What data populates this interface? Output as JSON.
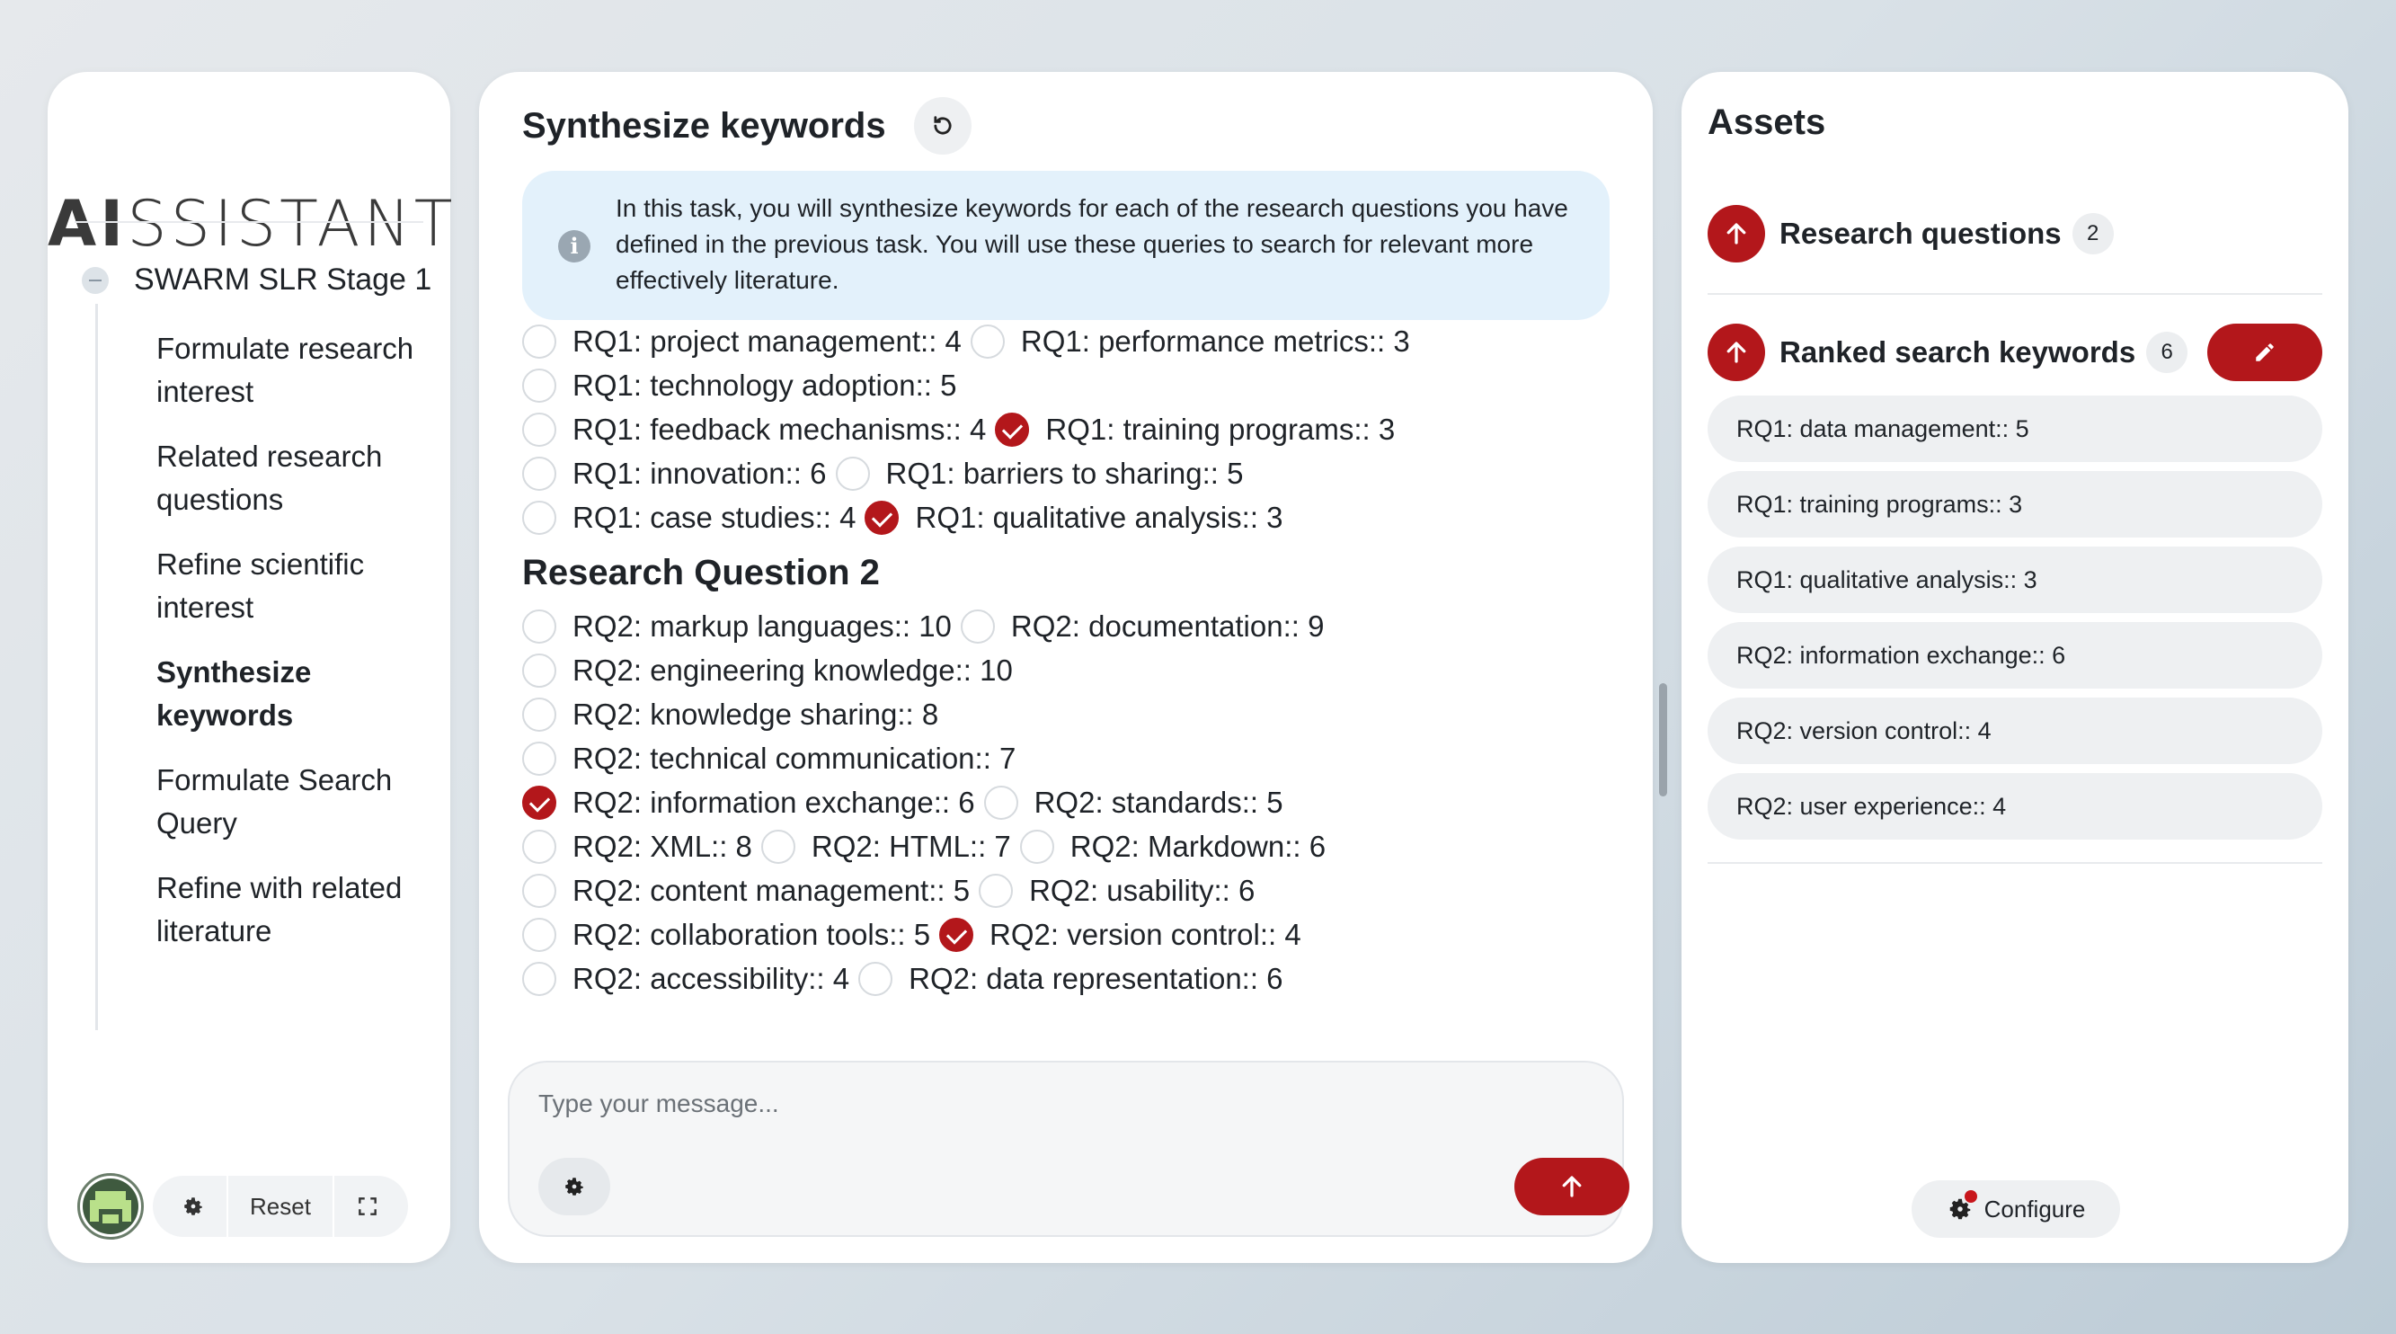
{
  "left_panel": {
    "logo_bold": "AI",
    "logo_rest": "SSISTANT",
    "stage_label": "SWARM SLR Stage 1",
    "nav_items": [
      {
        "label": "Formulate research interest"
      },
      {
        "label": "Related research questions"
      },
      {
        "label": "Refine scientific interest"
      },
      {
        "label": "Synthesize keywords"
      },
      {
        "label": "Formulate Search Query"
      },
      {
        "label": "Refine with related literature"
      }
    ],
    "active_index": 3,
    "reset_label": "Reset"
  },
  "main": {
    "title": "Synthesize keywords",
    "info_text": "In this task, you will synthesize keywords for each of the research questions you have defined in the previous task. You will use these queries to search for relevant more effectively literature.",
    "rq1_rows": [
      [
        {
          "label": "RQ1: project management:: 4",
          "checked": false
        },
        {
          "label": "RQ1: performance metrics:: 3",
          "checked": false
        }
      ],
      [
        {
          "label": "RQ1: technology adoption:: 5",
          "checked": false
        }
      ],
      [
        {
          "label": "RQ1: feedback mechanisms:: 4",
          "checked": false
        },
        {
          "label": "RQ1: training programs:: 3",
          "checked": true
        }
      ],
      [
        {
          "label": "RQ1: innovation:: 6",
          "checked": false
        },
        {
          "label": "RQ1: barriers to sharing:: 5",
          "checked": false
        }
      ],
      [
        {
          "label": "RQ1: case studies:: 4",
          "checked": false
        },
        {
          "label": "RQ1: qualitative analysis:: 3",
          "checked": true
        }
      ]
    ],
    "rq2_heading": "Research Question 2",
    "rq2_rows": [
      [
        {
          "label": "RQ2: markup languages:: 10",
          "checked": false
        },
        {
          "label": "RQ2: documentation:: 9",
          "checked": false
        }
      ],
      [
        {
          "label": "RQ2: engineering knowledge:: 10",
          "checked": false
        }
      ],
      [
        {
          "label": "RQ2: knowledge sharing:: 8",
          "checked": false
        }
      ],
      [
        {
          "label": "RQ2: technical communication:: 7",
          "checked": false
        }
      ],
      [
        {
          "label": "RQ2: information exchange:: 6",
          "checked": true
        },
        {
          "label": "RQ2: standards:: 5",
          "checked": false
        }
      ],
      [
        {
          "label": "RQ2: XML:: 8",
          "checked": false
        },
        {
          "label": "RQ2: HTML:: 7",
          "checked": false
        },
        {
          "label": "RQ2: Markdown:: 6",
          "checked": false
        }
      ],
      [
        {
          "label": "RQ2: content management:: 5",
          "checked": false
        },
        {
          "label": "RQ2: usability:: 6",
          "checked": false
        }
      ],
      [
        {
          "label": "RQ2: collaboration tools:: 5",
          "checked": false
        },
        {
          "label": "RQ2: version control:: 4",
          "checked": true
        }
      ],
      [
        {
          "label": "RQ2: accessibility:: 4",
          "checked": false
        },
        {
          "label": "RQ2: data representation:: 6",
          "checked": false
        }
      ]
    ],
    "composer": {
      "placeholder": "Type your message..."
    }
  },
  "assets": {
    "title": "Assets",
    "research_questions": {
      "label": "Research questions",
      "count": "2"
    },
    "ranked_keywords": {
      "label": "Ranked search keywords",
      "count": "6",
      "items": [
        "RQ1: data management:: 5",
        "RQ1: training programs:: 3",
        "RQ1: qualitative analysis:: 3",
        "RQ2: information exchange:: 6",
        "RQ2: version control:: 4",
        "RQ2: user experience:: 4"
      ]
    },
    "configure_label": "Configure"
  },
  "colors": {
    "accent": "#b3171b",
    "info_bg": "#e3f1fb"
  },
  "icons": [
    "minus-icon",
    "gear-icon",
    "fullscreen-icon",
    "refresh-icon",
    "info-icon",
    "arrow-up-icon",
    "pencil-icon"
  ]
}
